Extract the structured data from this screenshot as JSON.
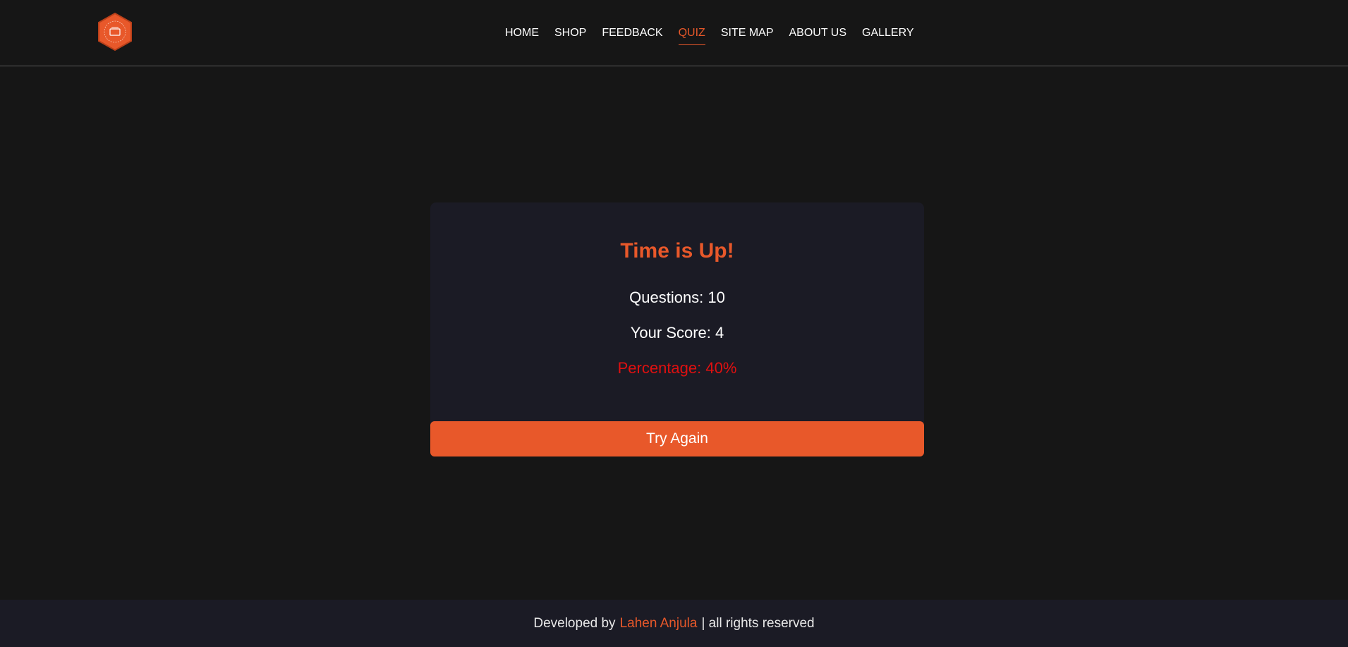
{
  "header": {
    "logo_icon": "hexagon-badge-logo-icon",
    "nav": [
      {
        "label": "HOME",
        "active": false
      },
      {
        "label": "SHOP",
        "active": false
      },
      {
        "label": "FEEDBACK",
        "active": false
      },
      {
        "label": "QUIZ",
        "active": true
      },
      {
        "label": "SITE MAP",
        "active": false
      },
      {
        "label": "ABOUT US",
        "active": false
      },
      {
        "label": "GALLERY",
        "active": false
      }
    ]
  },
  "result": {
    "title": "Time is Up!",
    "questions": "Questions: 10",
    "score": "Your Score: 4",
    "percentage": "Percentage: 40%",
    "button": "Try Again"
  },
  "footer": {
    "prefix": "Developed by",
    "name": "Lahen Anjula",
    "suffix": "| all rights reserved"
  },
  "colors": {
    "accent": "#e8582a",
    "background": "#161616",
    "card": "#1b1b25",
    "percentage": "#e01010"
  }
}
